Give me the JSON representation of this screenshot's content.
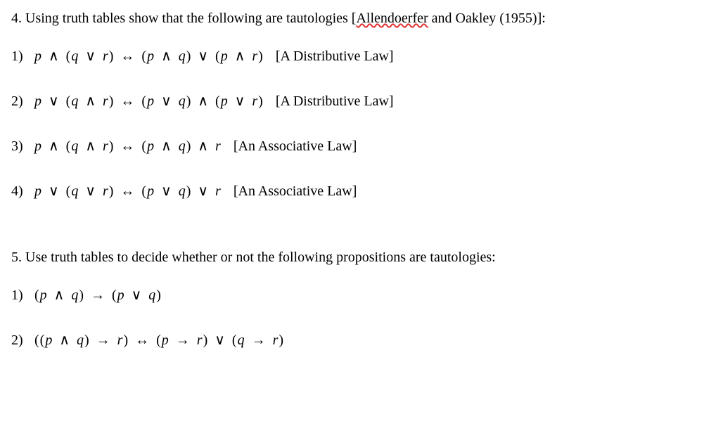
{
  "q4": {
    "prompt_pre": "4. Using truth tables show that the following are tautologies [",
    "prompt_name": "Allendoerfer",
    "prompt_post": " and Oakley (1955)]:",
    "items": [
      {
        "num": "1)",
        "math_html": "p <span class='op'>∧</span> <span class='paren'>(</span>q <span class='op'>∨</span> r<span class='paren'>)</span> <span class='op'>↔</span> <span class='paren'>(</span>p <span class='op'>∧</span> q<span class='paren'>)</span> <span class='op'>∨</span> <span class='paren'>(</span>p <span class='op'>∧</span> r<span class='paren'>)</span>",
        "label": "[A Distributive Law]"
      },
      {
        "num": "2)",
        "math_html": "p <span class='op'>∨</span> <span class='paren'>(</span>q <span class='op'>∧</span> r<span class='paren'>)</span> <span class='op'>↔</span> <span class='paren'>(</span>p <span class='op'>∨</span> q<span class='paren'>)</span> <span class='op'>∧</span> <span class='paren'>(</span>p <span class='op'>∨</span> r<span class='paren'>)</span>",
        "label": "[A Distributive Law]"
      },
      {
        "num": "3)",
        "math_html": "p <span class='op'>∧</span> <span class='paren'>(</span>q <span class='op'>∧</span> r<span class='paren'>)</span> <span class='op'>↔</span> <span class='paren'>(</span>p <span class='op'>∧</span> q<span class='paren'>)</span> <span class='op'>∧</span> r",
        "label": "[An Associative Law]"
      },
      {
        "num": "4)",
        "math_html": "p <span class='op'>∨</span> <span class='paren'>(</span>q <span class='op'>∨</span> r<span class='paren'>)</span> <span class='op'>↔</span> <span class='paren'>(</span>p <span class='op'>∨</span> q<span class='paren'>)</span> <span class='op'>∨</span> r",
        "label": "[An Associative Law]"
      }
    ]
  },
  "q5": {
    "prompt": "5. Use truth tables to decide whether or not the following propositions are tautologies:",
    "items": [
      {
        "num": "1)",
        "math_html": "<span class='paren'>(</span>p <span class='op'>∧</span> q<span class='paren'>)</span> <span class='op'>→</span> <span class='paren'>(</span>p <span class='op'>∨</span> q<span class='paren'>)</span>"
      },
      {
        "num": "2)",
        "math_html": "<span class='paren'>((</span>p <span class='op'>∧</span> q<span class='paren'>)</span> <span class='op'>→</span> r<span class='paren'>)</span> <span class='op'>↔</span> <span class='paren'>(</span>p <span class='op'>→</span> r<span class='paren'>)</span> <span class='op'>∨</span> <span class='paren'>(</span>q <span class='op'>→</span> r<span class='paren'>)</span>"
      }
    ]
  }
}
